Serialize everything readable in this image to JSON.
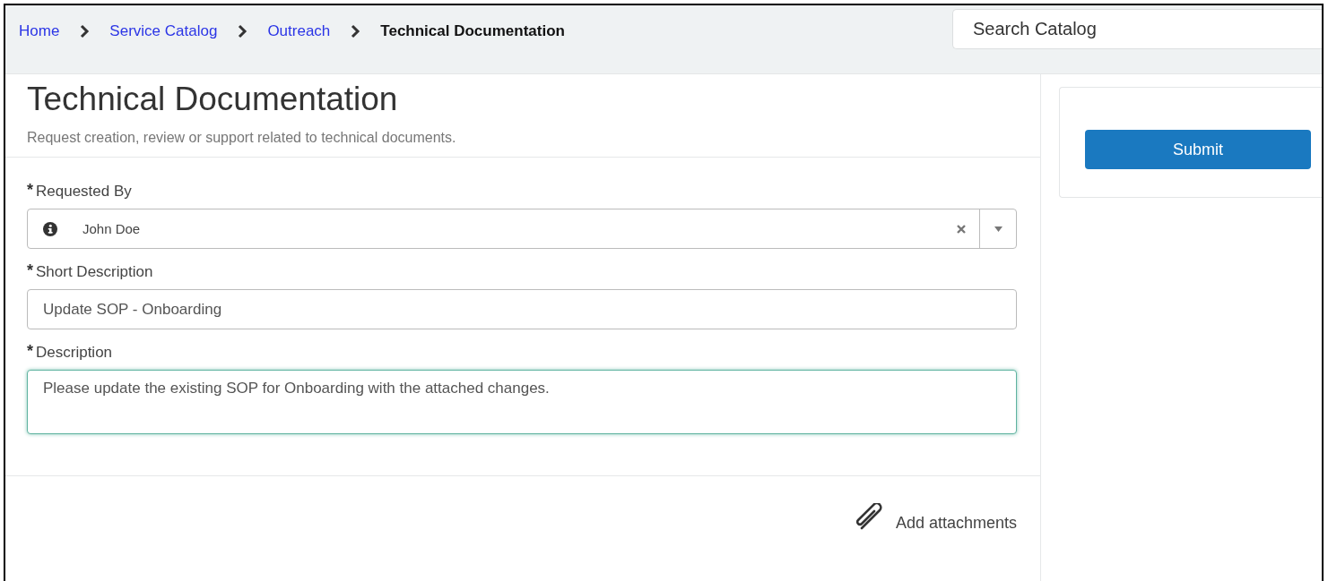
{
  "breadcrumb": [
    {
      "label": "Home",
      "current": false
    },
    {
      "label": "Service Catalog",
      "current": false
    },
    {
      "label": "Outreach",
      "current": false
    },
    {
      "label": "Technical Documentation",
      "current": true
    }
  ],
  "search": {
    "placeholder": "Search Catalog"
  },
  "form": {
    "title": "Technical Documentation",
    "subtitle": "Request creation, review or support related to technical documents.",
    "fields": [
      {
        "kind": "reference",
        "marker": "*",
        "label": "Requested By",
        "value": "John Doe",
        "focused": false
      },
      {
        "kind": "text",
        "marker": "*",
        "label": "Short Description",
        "value": "Update SOP - Onboarding",
        "focused": false
      },
      {
        "kind": "textarea",
        "marker": "*",
        "label": "Description",
        "value": "Please update the existing SOP for Onboarding with the attached changes.",
        "focused": true
      }
    ],
    "attachments": "Add attachments"
  },
  "submit_button": "Submit"
}
